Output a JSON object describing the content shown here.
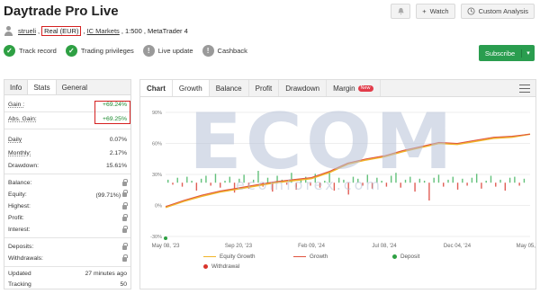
{
  "header": {
    "title": "Daytrade Pro Live",
    "watch_label": "Watch",
    "custom_analysis_label": "Custom Analysis"
  },
  "subline": {
    "user": "strueli",
    "account_type": "Real (EUR)",
    "broker": "IC Markets",
    "rest": ", 1:500 , MetaTrader 4"
  },
  "badges": [
    {
      "label": "Track record",
      "icon": "check-icon",
      "color": "#2ea043"
    },
    {
      "label": "Trading privileges",
      "icon": "check-icon",
      "color": "#2ea043"
    },
    {
      "label": "Live update",
      "icon": "exclamation-icon",
      "color": "#9a9a9a"
    },
    {
      "label": "Cashback",
      "icon": "exclamation-icon",
      "color": "#9a9a9a"
    }
  ],
  "subscribe_label": "Subscribe",
  "left_tabs": [
    "Info",
    "Stats",
    "General"
  ],
  "stats": {
    "gain": {
      "label": "Gain :",
      "value": "+69.24%"
    },
    "abs_gain": {
      "label": "Abs. Gain:",
      "value": "+69.25%"
    },
    "daily": {
      "label": "Daily",
      "value": "0.07%"
    },
    "monthly": {
      "label": "Monthly:",
      "value": "2.17%"
    },
    "drawdown": {
      "label": "Drawdown:",
      "value": "15.61%"
    },
    "balance": {
      "label": "Balance:"
    },
    "equity": {
      "label": "Equity:",
      "value": "(99.71%)"
    },
    "highest": {
      "label": "Highest:"
    },
    "profit": {
      "label": "Profit:"
    },
    "interest": {
      "label": "Interest:"
    },
    "deposits": {
      "label": "Deposits:"
    },
    "withdrawals": {
      "label": "Withdrawals:"
    },
    "updated": {
      "label": "Updated",
      "value": "27 minutes ago"
    },
    "tracking": {
      "label": "Tracking",
      "value": "50"
    }
  },
  "right_tabs": [
    "Chart",
    "Growth",
    "Balance",
    "Profit",
    "Drawdown",
    "Margin"
  ],
  "new_badge": "New",
  "watermark": {
    "big": "ECOM",
    "small": "ecomforex.com"
  },
  "colors": {
    "green": "#1b8a2e",
    "red_box": "#d52020",
    "equity_line": "#f0b429",
    "growth_line": "#e0533f",
    "deposit": "#2ea043",
    "withdrawal": "#d9342b"
  },
  "chart_data": {
    "type": "line",
    "y_ticks": [
      "90%",
      "60%",
      "30%",
      "0%",
      "-30%"
    ],
    "x_ticks": [
      "May 08, '23",
      "Sep 20, '23",
      "Feb 09, '24",
      "Jul 08, '24",
      "Dec 04, '24",
      "May 05, '25"
    ],
    "ylim": [
      -30,
      90
    ],
    "series": [
      {
        "name": "Equity Growth",
        "x": [
          0,
          5,
          10,
          15,
          20,
          25,
          30,
          35,
          40,
          45,
          50,
          55,
          60,
          65,
          70,
          75,
          80,
          85,
          90,
          95,
          100
        ],
        "values": [
          -2,
          4,
          9,
          13,
          16,
          19,
          22,
          24,
          26,
          32,
          40,
          44,
          47,
          52,
          56,
          60,
          59,
          62,
          65,
          66,
          69
        ]
      },
      {
        "name": "Growth",
        "x": [
          0,
          5,
          10,
          15,
          20,
          25,
          30,
          35,
          40,
          45,
          50,
          55,
          60,
          65,
          70,
          75,
          80,
          85,
          90,
          95,
          100
        ],
        "values": [
          -1,
          5,
          10,
          14,
          17,
          20,
          23,
          25,
          27,
          33,
          41,
          45,
          48,
          53,
          57,
          61,
          60,
          63,
          66,
          67,
          69
        ]
      }
    ],
    "extra_legend": [
      "Deposit",
      "Withdrawal"
    ],
    "bars": [
      3,
      -2,
      5,
      -4,
      6,
      2,
      -8,
      4,
      7,
      -3,
      9,
      -5,
      2,
      6,
      -10,
      4,
      8,
      -6,
      3,
      12,
      -4,
      5,
      -9,
      7,
      3,
      -2,
      10,
      -7,
      4,
      6,
      -3,
      9,
      -5,
      2,
      11,
      -8,
      5,
      3,
      -12,
      6,
      4,
      -3,
      8,
      -6,
      5,
      2,
      -4,
      7,
      10,
      -5,
      3,
      6,
      -9,
      4,
      2,
      -18,
      5,
      8,
      -4,
      3,
      6,
      -7,
      4,
      -3,
      5,
      9,
      -6,
      2,
      7,
      -4,
      3,
      -8,
      5,
      6,
      -3,
      4
    ]
  }
}
